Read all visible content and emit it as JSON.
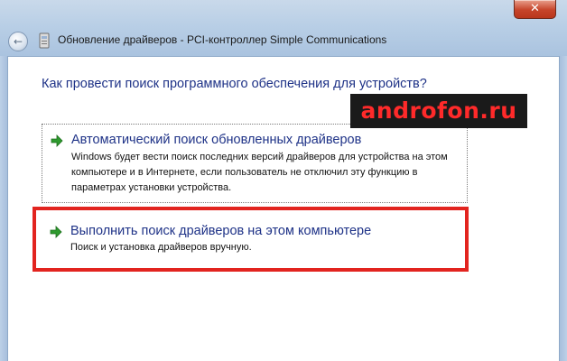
{
  "window": {
    "title": "Обновление драйверов - PCI-контроллер Simple Communications",
    "close_label": "✕",
    "back_label": "←"
  },
  "content": {
    "question": "Как провести поиск программного обеспечения для устройств?",
    "options": [
      {
        "title": "Автоматический поиск обновленных драйверов",
        "description": "Windows будет вести поиск последних версий драйверов для устройства на этом компьютере и в Интернете, если пользователь не отключил эту функцию в параметрах установки устройства."
      },
      {
        "title": "Выполнить поиск драйверов на этом компьютере",
        "description": "Поиск и установка драйверов вручную."
      }
    ]
  },
  "watermark": "androfon.ru",
  "colors": {
    "link_blue": "#1e3287",
    "highlight_red": "#e2241f",
    "arrow_green": "#2e9a2e",
    "watermark_red": "#ff2a2a"
  },
  "icons": {
    "option_arrow": "green-arrow-icon",
    "device": "device-icon",
    "back": "back-arrow-icon",
    "close": "close-icon"
  }
}
